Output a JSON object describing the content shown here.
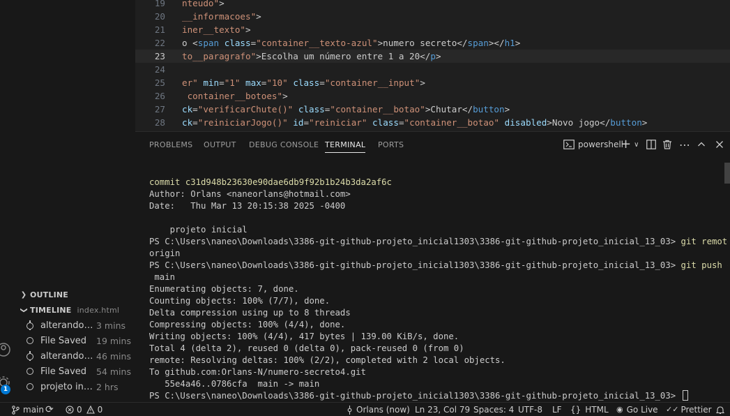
{
  "editor": {
    "lines": [
      {
        "num": "19",
        "parts": [
          [
            "st",
            "nteudo\""
          ],
          [
            "tx",
            ">"
          ]
        ]
      },
      {
        "num": "20",
        "parts": [
          [
            "st",
            "__informacoes\""
          ],
          [
            "tx",
            ">"
          ]
        ]
      },
      {
        "num": "21",
        "parts": [
          [
            "st",
            "iner__texto\""
          ],
          [
            "tx",
            ">"
          ]
        ]
      },
      {
        "num": "22",
        "parts": [
          [
            "tx",
            "o <"
          ],
          [
            "tg",
            "span"
          ],
          [
            "tx",
            " "
          ],
          [
            "at",
            "class"
          ],
          [
            "tx",
            "="
          ],
          [
            "st",
            "\"container__texto-azul\""
          ],
          [
            "tx",
            ">numero secreto</"
          ],
          [
            "tg",
            "span"
          ],
          [
            "tx",
            "></"
          ],
          [
            "tg",
            "h1"
          ],
          [
            "tx",
            ">"
          ]
        ]
      },
      {
        "num": "23",
        "parts": [
          [
            "st",
            "to__paragrafo\""
          ],
          [
            "tx",
            ">Escolha um número entre 1 a 20</"
          ],
          [
            "tg",
            "p"
          ],
          [
            "tx",
            ">"
          ]
        ],
        "current": true
      },
      {
        "num": "24",
        "parts": []
      },
      {
        "num": "25",
        "parts": [
          [
            "st",
            "er\""
          ],
          [
            "tx",
            " "
          ],
          [
            "at",
            "min"
          ],
          [
            "tx",
            "="
          ],
          [
            "st",
            "\"1\""
          ],
          [
            "tx",
            " "
          ],
          [
            "at",
            "max"
          ],
          [
            "tx",
            "="
          ],
          [
            "st",
            "\"10\""
          ],
          [
            "tx",
            " "
          ],
          [
            "at",
            "class"
          ],
          [
            "tx",
            "="
          ],
          [
            "st",
            "\"container__input\""
          ],
          [
            "tx",
            ">"
          ]
        ]
      },
      {
        "num": "26",
        "parts": [
          [
            "st",
            " container__botoes\""
          ],
          [
            "tx",
            ">"
          ]
        ]
      },
      {
        "num": "27",
        "parts": [
          [
            "at",
            "ck"
          ],
          [
            "tx",
            "="
          ],
          [
            "st",
            "\"verificarChute()\""
          ],
          [
            "tx",
            " "
          ],
          [
            "at",
            "class"
          ],
          [
            "tx",
            "="
          ],
          [
            "st",
            "\"container__botao\""
          ],
          [
            "tx",
            ">Chutar</"
          ],
          [
            "tg",
            "button"
          ],
          [
            "tx",
            ">"
          ]
        ]
      },
      {
        "num": "28",
        "parts": [
          [
            "at",
            "ck"
          ],
          [
            "tx",
            "="
          ],
          [
            "st",
            "\"reiniciarJogo()\""
          ],
          [
            "tx",
            " "
          ],
          [
            "at",
            "id"
          ],
          [
            "tx",
            "="
          ],
          [
            "st",
            "\"reiniciar\""
          ],
          [
            "tx",
            " "
          ],
          [
            "at",
            "class"
          ],
          [
            "tx",
            "="
          ],
          [
            "st",
            "\"container__botao\""
          ],
          [
            "tx",
            " "
          ],
          [
            "at",
            "disabled"
          ],
          [
            "tx",
            ">Novo jogo</"
          ],
          [
            "tg",
            "button"
          ],
          [
            "tx",
            ">"
          ]
        ]
      }
    ]
  },
  "sidebar": {
    "outline_label": "OUTLINE",
    "timeline_label": "TIMELINE",
    "timeline_file": "index.html",
    "timeline_items": [
      {
        "kind": "git",
        "label": "alterando li...",
        "time": "3 mins"
      },
      {
        "kind": "save",
        "label": "File Saved",
        "time": "19 mins"
      },
      {
        "kind": "git",
        "label": "alterando li...",
        "time": "46 mins"
      },
      {
        "kind": "save",
        "label": "File Saved",
        "time": "54 mins"
      },
      {
        "kind": "save",
        "label": "projeto inicial...",
        "time": "2 hrs"
      }
    ],
    "badge_count": "1"
  },
  "panel": {
    "tabs": [
      "PROBLEMS",
      "OUTPUT",
      "DEBUG CONSOLE",
      "TERMINAL",
      "PORTS"
    ],
    "active_tab": "TERMINAL",
    "shell_label": "powershell"
  },
  "terminal": {
    "lines": [
      {
        "style": "y",
        "text": "commit c31d948b23630e90dae6db9f92b1b24b3da2af6c"
      },
      {
        "style": "",
        "text": "Author: Orlans <naneorlans@hotmail.com>"
      },
      {
        "style": "",
        "text": "Date:   Thu Mar 13 20:15:38 2025 -0400"
      },
      {
        "style": "",
        "text": ""
      },
      {
        "style": "",
        "text": "    projeto inicial"
      },
      {
        "style": "ps",
        "text": "PS C:\\Users\\naneo\\Downloads\\3386-git-github-projeto_inicial1303\\3386-git-github-projeto_inicial_13_03> ",
        "cmd": "git remote"
      },
      {
        "style": "",
        "text": "origin"
      },
      {
        "style": "ps",
        "text": "PS C:\\Users\\naneo\\Downloads\\3386-git-github-projeto_inicial1303\\3386-git-github-projeto_inicial_13_03> ",
        "cmd": "git push origin"
      },
      {
        "style": "",
        "text": " main"
      },
      {
        "style": "",
        "text": "Enumerating objects: 7, done."
      },
      {
        "style": "",
        "text": "Counting objects: 100% (7/7), done."
      },
      {
        "style": "",
        "text": "Delta compression using up to 8 threads"
      },
      {
        "style": "",
        "text": "Compressing objects: 100% (4/4), done."
      },
      {
        "style": "",
        "text": "Writing objects: 100% (4/4), 417 bytes | 139.00 KiB/s, done."
      },
      {
        "style": "",
        "text": "Total 4 (delta 2), reused 0 (delta 0), pack-reused 0 (from 0)"
      },
      {
        "style": "",
        "text": "remote: Resolving deltas: 100% (2/2), completed with 2 local objects."
      },
      {
        "style": "",
        "text": "To github.com:Orlans-N/numero-secreto4.git"
      },
      {
        "style": "",
        "text": "   55e4a46..0786cfa  main -> main"
      },
      {
        "style": "prompt",
        "text": "PS C:\\Users\\naneo\\Downloads\\3386-git-github-projeto_inicial1303\\3386-git-github-projeto_inicial_13_03> "
      }
    ]
  },
  "status": {
    "branch": "main",
    "errors": "0",
    "warnings": "0",
    "author": "Orlans (now)",
    "position": "Ln 23, Col 79",
    "spaces": "Spaces: 4",
    "encoding": "UTF-8",
    "eol": "LF",
    "language": "HTML",
    "golive": "Go Live",
    "prettier": "Prettier"
  }
}
